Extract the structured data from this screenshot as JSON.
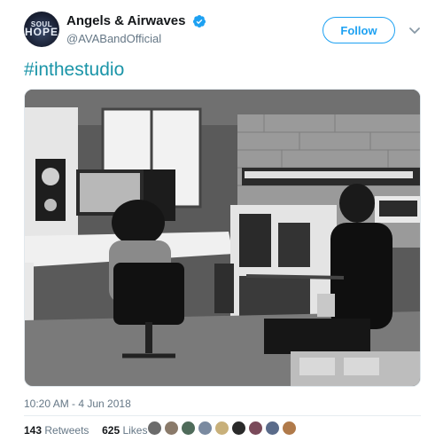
{
  "author": {
    "display_name": "Angels & Airwaves",
    "handle": "@AVABandOfficial",
    "avatar_line1": "SOUL",
    "avatar_line2": "HOPE",
    "verified": true
  },
  "follow_label": "Follow",
  "tweet": {
    "text": "#inthestudio",
    "timestamp": "10:20 AM - 4 Jun 2018"
  },
  "stats": {
    "retweets_count": "143",
    "retweets_label": "Retweets",
    "likes_count": "625",
    "likes_label": "Likes"
  },
  "likers": [
    {
      "color": "#6b6b6b"
    },
    {
      "color": "#8a7a6a"
    },
    {
      "color": "#4f6b5a"
    },
    {
      "color": "#7a8aa0"
    },
    {
      "color": "#c8b07a"
    },
    {
      "color": "#2a2a2a"
    },
    {
      "color": "#7a4a5a"
    },
    {
      "color": "#5a6b8a"
    },
    {
      "color": "#b07a4a"
    }
  ],
  "colors": {
    "accent": "#1da1f2",
    "hashtag": "#1b95a8",
    "muted": "#657786"
  }
}
